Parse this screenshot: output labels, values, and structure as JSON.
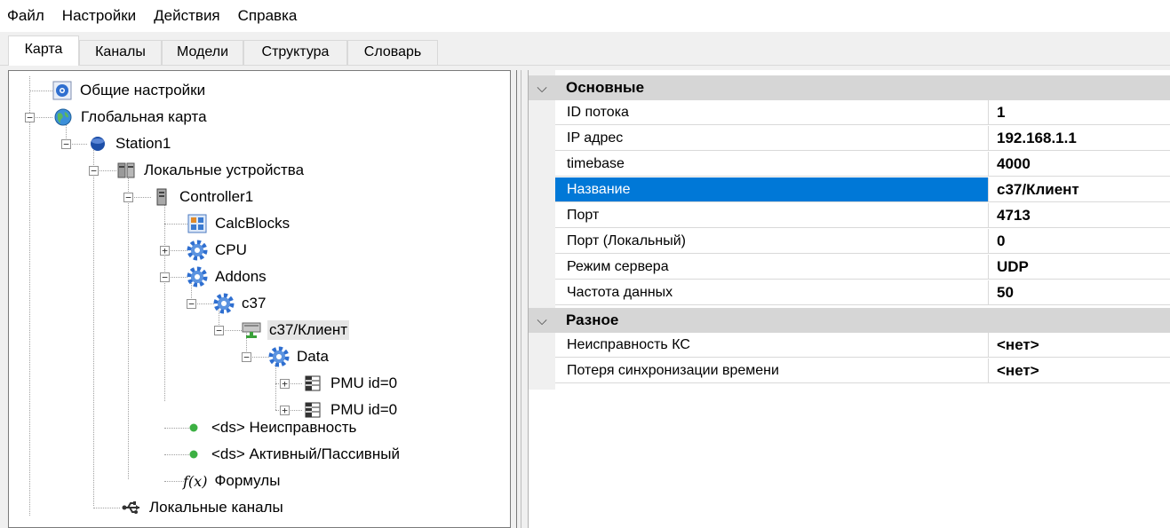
{
  "menu": [
    "Файл",
    "Настройки",
    "Действия",
    "Справка"
  ],
  "tabs": [
    "Карта",
    "Каналы",
    "Модели",
    "Структура",
    "Словарь"
  ],
  "active_tab": "Карта",
  "tree": {
    "general_settings": "Общие настройки",
    "global_map": "Глобальная карта",
    "station": "Station1",
    "local_devices": "Локальные устройства",
    "controller": "Controller1",
    "calcblocks": "CalcBlocks",
    "cpu": "CPU",
    "addons": "Addons",
    "c37": "c37",
    "c37_client": "c37/Клиент",
    "data": "Data",
    "pmu1": "PMU id=0",
    "pmu2": "PMU id=0",
    "ds_fault": "<ds> Неисправность",
    "ds_active": "<ds> Активный/Пассивный",
    "formulas": "Формулы",
    "local_channels": "Локальные каналы",
    "formula_glyph": "f(x)"
  },
  "properties": {
    "chevron": "⌵",
    "categories": [
      {
        "name": "Основные",
        "rows": [
          {
            "name": "ID потока",
            "value": "1"
          },
          {
            "name": "IP адрес",
            "value": "192.168.1.1"
          },
          {
            "name": "timebase",
            "value": "4000"
          },
          {
            "name": "Название",
            "value": "c37/Клиент"
          },
          {
            "name": "Порт",
            "value": "4713"
          },
          {
            "name": "Порт (Локальный)",
            "value": "0"
          },
          {
            "name": "Режим сервера",
            "value": "UDP"
          },
          {
            "name": "Частота данных",
            "value": "50"
          }
        ]
      },
      {
        "name": "Разное",
        "rows": [
          {
            "name": "Неисправность КС",
            "value": "<нет>"
          },
          {
            "name": "Потеря синхронизации времени",
            "value": "<нет>"
          }
        ]
      }
    ]
  },
  "colors": {
    "selection_blue": "#0078d7",
    "category_bg": "#d6d6d6",
    "status_green": "#3cb043"
  },
  "icons": {
    "general_settings": "settings-globe-icon",
    "global_map": "globe-icon",
    "station": "station-icon",
    "local_devices": "devices-icon",
    "controller": "server-icon",
    "calcblocks": "calcblocks-icon",
    "gear": "gear-icon",
    "c37_client": "network-client-icon",
    "pmu": "table-icon",
    "status": "green-dot-icon",
    "formula": "formula-icon",
    "usb": "usb-icon"
  }
}
